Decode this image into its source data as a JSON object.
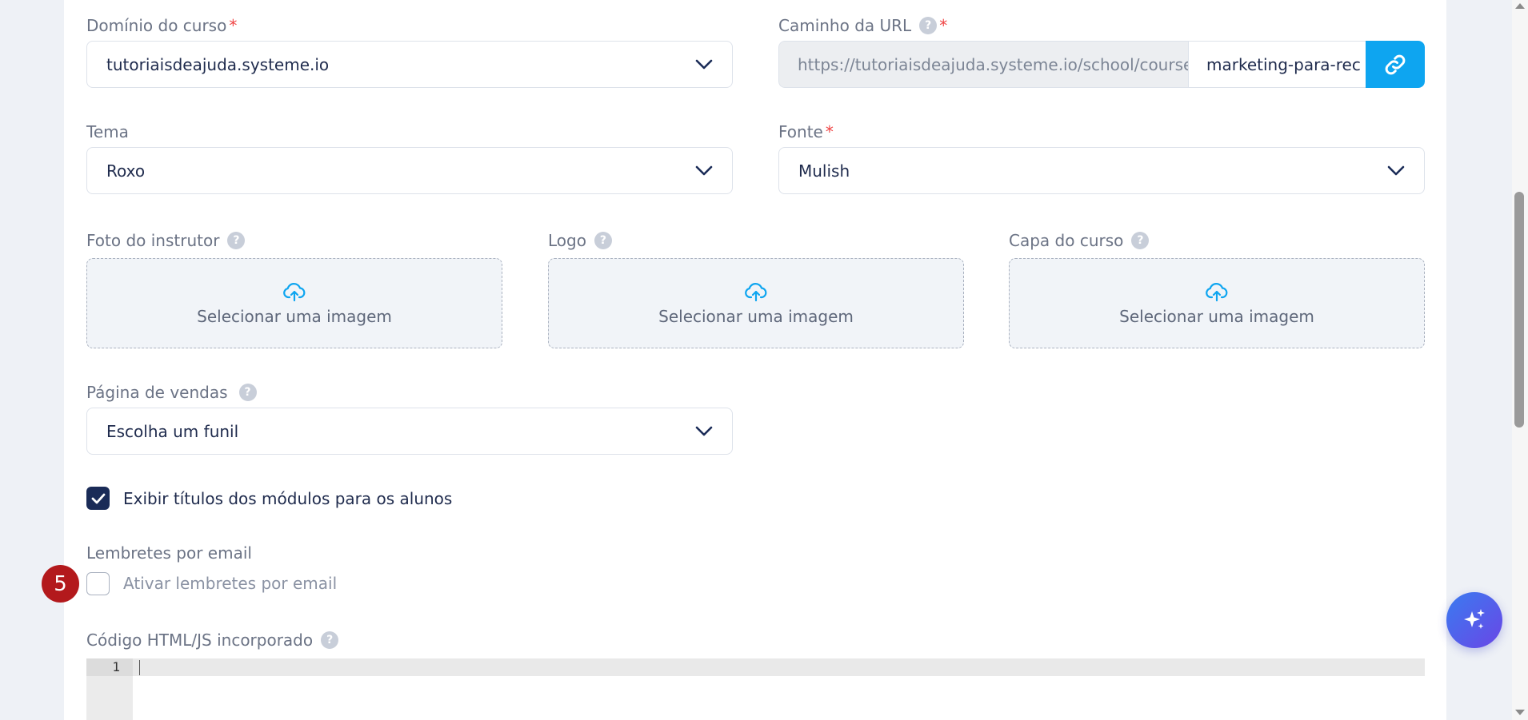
{
  "form": {
    "domain": {
      "label": "Domínio do curso",
      "required_mark": "*",
      "value": "tutoriaisdeajuda.systeme.io",
      "icon": "chevron-down-icon"
    },
    "url_path": {
      "label": "Caminho da URL",
      "help": "?",
      "required_mark": "*",
      "prefix": "https://tutoriaisdeajuda.systeme.io/school/course/",
      "slug": "marketing-para-rec",
      "button_icon": "link-icon"
    },
    "theme": {
      "label": "Tema",
      "value": "Roxo"
    },
    "font": {
      "label": "Fonte",
      "required_mark": "*",
      "value": "Mulish"
    },
    "uploads": [
      {
        "label": "Foto do instrutor",
        "help": "?",
        "text": "Selecionar uma imagem",
        "icon": "cloud-upload-icon"
      },
      {
        "label": "Logo",
        "help": "?",
        "text": "Selecionar uma imagem",
        "icon": "cloud-upload-icon"
      },
      {
        "label": "Capa do curso",
        "help": "?",
        "text": "Selecionar uma imagem",
        "icon": "cloud-upload-icon"
      }
    ],
    "sales_page": {
      "label": "Página de vendas",
      "help": "?",
      "value": "Escolha um funil"
    },
    "show_module_titles": {
      "label": "Exibir títulos dos módulos para os alunos",
      "checked": true
    },
    "email_reminders": {
      "section_label": "Lembretes por email",
      "label": "Ativar lembretes por email",
      "checked": false
    },
    "embed_code": {
      "label": "Código HTML/JS incorporado",
      "help": "?",
      "line_number": "1"
    }
  },
  "step_badge": "5",
  "colors": {
    "primary_navy": "#1a2b57",
    "link_button": "#0ea5f0",
    "required": "#ef4444",
    "badge": "#b3191c"
  }
}
